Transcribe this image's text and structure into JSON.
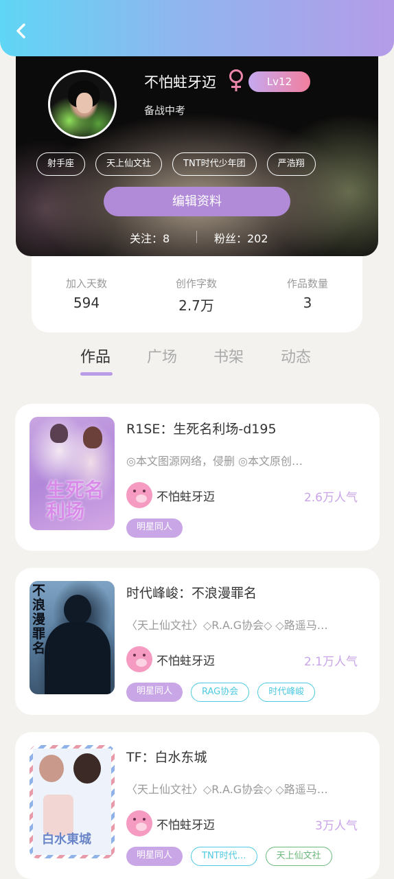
{
  "header": {
    "back_label": "返回"
  },
  "profile": {
    "username": "不怕蛀牙迈",
    "gender_symbol": "♀",
    "level": "Lv12",
    "signature": "备战中考",
    "tags": [
      "射手座",
      "天上仙文社",
      "TNT时代少年团",
      "严浩翔"
    ],
    "edit_label": "编辑资料",
    "following_text": "关注：8",
    "followers_text": "粉丝：202"
  },
  "stats": [
    {
      "label": "加入天数",
      "value": "594"
    },
    {
      "label": "创作字数",
      "value": "2.7万"
    },
    {
      "label": "作品数量",
      "value": "3"
    }
  ],
  "tabs": [
    "作品",
    "广场",
    "书架",
    "动态"
  ],
  "active_tab": "作品",
  "works": [
    {
      "title": "R1SE：生死名利场-d195",
      "desc": "◎本文图源网络，侵删      ◎本文原创…",
      "author": "不怕蛀牙迈",
      "popularity": "2.6万人气",
      "cover_text": "生死名利场",
      "tags": [
        {
          "label": "明星同人",
          "style": "filled"
        }
      ]
    },
    {
      "title": "时代峰峻：不浪漫罪名",
      "desc": "〈天上仙文社〉◇R.A.G协会◇ ◇路遥马…",
      "author": "不怕蛀牙迈",
      "popularity": "2.1万人气",
      "cover_text": "不浪漫罪名",
      "tags": [
        {
          "label": "明星同人",
          "style": "filled"
        },
        {
          "label": "RAG协会",
          "style": "outline-cyan"
        },
        {
          "label": "时代峰峻",
          "style": "outline-cyan"
        }
      ]
    },
    {
      "title": "TF：白水东城",
      "desc": "〈天上仙文社〉◇R.A.G协会◇ ◇路遥马…",
      "author": "不怕蛀牙迈",
      "popularity": "3万人气",
      "cover_text": "白水東城",
      "tags": [
        {
          "label": "明星同人",
          "style": "filled"
        },
        {
          "label": "TNT时代…",
          "style": "outline-cyan"
        },
        {
          "label": "天上仙文社",
          "style": "outline-green"
        }
      ]
    }
  ],
  "colors": {
    "accent_purple": "#b18ad8",
    "tag_cyan": "#4ec9e0",
    "tag_green": "#6ab87a",
    "popularity": "#c9a4e8"
  }
}
